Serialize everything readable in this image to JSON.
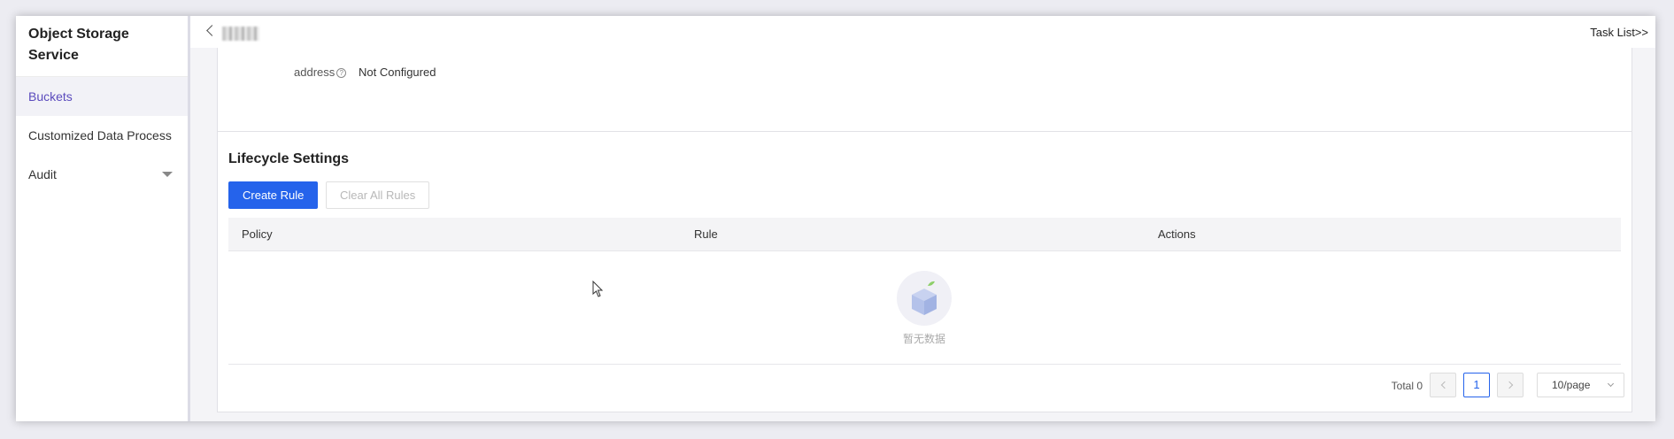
{
  "sidebar": {
    "title": "Object Storage Service",
    "items": [
      {
        "label": "Buckets",
        "active": true
      },
      {
        "label": "Customized Data Process",
        "active": false
      },
      {
        "label": "Audit",
        "active": false,
        "expandable": true
      }
    ]
  },
  "topbar": {
    "back_icon": "chevron-left-icon",
    "task_list_label": "Task List>>"
  },
  "address": {
    "label": "address",
    "value": "Not Configured"
  },
  "lifecycle": {
    "title": "Lifecycle Settings",
    "create_rule_label": "Create Rule",
    "clear_rules_label": "Clear All Rules",
    "columns": [
      "Policy",
      "Rule",
      "Actions"
    ],
    "empty_text": "暂无数据"
  },
  "pagination": {
    "total_label": "Total 0",
    "current_page": "1",
    "page_size": "10/page"
  },
  "colors": {
    "primary": "#2563eb",
    "active_nav_text": "#5b4bbd"
  }
}
